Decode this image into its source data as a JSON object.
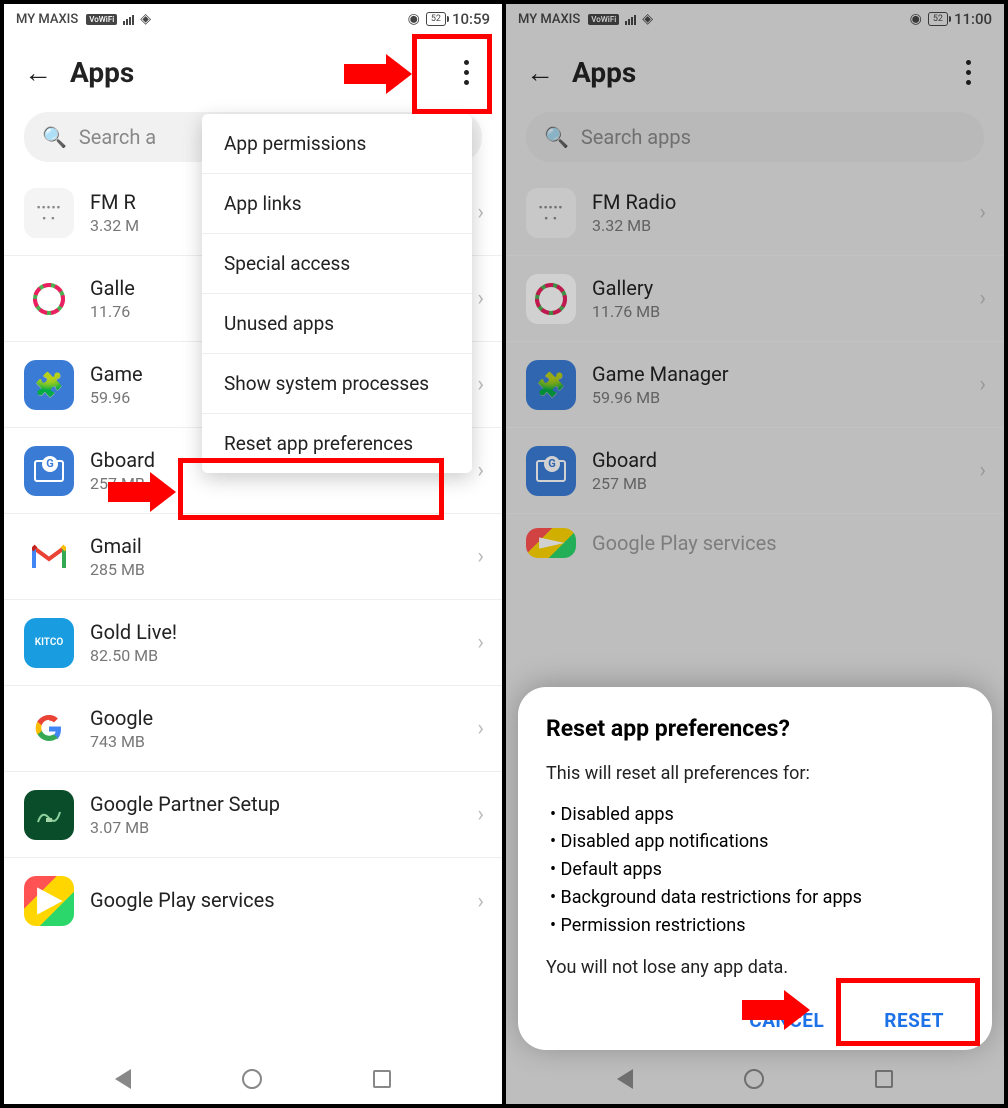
{
  "left": {
    "statusbar": {
      "carrier": "MY MAXIS",
      "vowifi": "VoWiFi",
      "battery": "52",
      "time": "10:59"
    },
    "title": "Apps",
    "search_placeholder": "Search apps",
    "search_visible_text": "Search a",
    "apps": [
      {
        "name_full": "FM Radio",
        "name": "FM R",
        "size": "3.32 MB",
        "size_cut": "3.32 M"
      },
      {
        "name_full": "Gallery",
        "name": "Galle",
        "size": "11.76 MB",
        "size_cut": "11.76"
      },
      {
        "name_full": "Game Manager",
        "name": "Game",
        "size": "59.96 MB",
        "size_cut": "59.96"
      },
      {
        "name_full": "Gboard",
        "name": "Gboard",
        "size": "257 MB",
        "size_cut": "257 MB"
      },
      {
        "name_full": "Gmail",
        "name": "Gmail",
        "size": "285 MB",
        "size_cut": "285 MB"
      },
      {
        "name_full": "Gold Live!",
        "name": "Gold Live!",
        "size": "82.50 MB",
        "size_cut": "82.50 MB"
      },
      {
        "name_full": "Google",
        "name": "Google",
        "size": "743 MB",
        "size_cut": "743 MB"
      },
      {
        "name_full": "Google Partner Setup",
        "name": "Google Partner Setup",
        "size": "3.07 MB",
        "size_cut": "3.07 MB"
      },
      {
        "name_full": "Google Play services",
        "name": "Google Play services",
        "size": "",
        "size_cut": ""
      }
    ],
    "menu": [
      "App permissions",
      "App links",
      "Special access",
      "Unused apps",
      "Show system processes",
      "Reset app preferences"
    ]
  },
  "right": {
    "statusbar": {
      "carrier": "MY MAXIS",
      "vowifi": "VoWiFi",
      "battery": "52",
      "time": "11:00"
    },
    "title": "Apps",
    "search_placeholder": "Search apps",
    "apps": [
      {
        "name": "FM Radio",
        "size": "3.32 MB"
      },
      {
        "name": "Gallery",
        "size": "11.76 MB"
      },
      {
        "name": "Game Manager",
        "size": "59.96 MB"
      },
      {
        "name": "Gboard",
        "size": "257 MB"
      }
    ],
    "modal": {
      "title": "Reset app preferences?",
      "intro": "This will reset all preferences for:",
      "bullets": [
        "Disabled apps",
        "Disabled app notifications",
        "Default apps",
        "Background data restrictions for apps",
        "Permission restrictions"
      ],
      "outro": "You will not lose any app data.",
      "cancel": "CANCEL",
      "reset": "RESET"
    },
    "bottom_peek": "Google Play services"
  }
}
